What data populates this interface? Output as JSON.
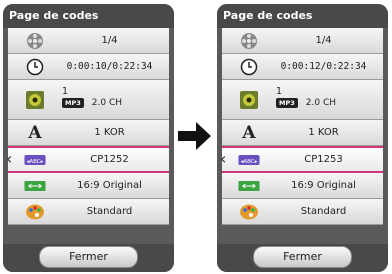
{
  "screens": [
    {
      "title": "Page de codes",
      "rows": {
        "title_num": "1/4",
        "time": "0:00:10/0:22:34",
        "audio_track": "1",
        "audio_codec": "MP3",
        "audio_channels": "2.0 CH",
        "subtitle_lang": "1 KOR",
        "code_page": "CP1252",
        "picture_size": "16:9 Original",
        "picture_mode": "Standard"
      },
      "close_label": "Fermer"
    },
    {
      "title": "Page de codes",
      "rows": {
        "title_num": "1/4",
        "time": "0:00:12/0:22:34",
        "audio_track": "1",
        "audio_codec": "MP3",
        "audio_channels": "2.0 CH",
        "subtitle_lang": "1 KOR",
        "code_page": "CP1253",
        "picture_size": "16:9 Original",
        "picture_mode": "Standard"
      },
      "close_label": "Fermer"
    }
  ],
  "icons": {
    "film": "film-reel-icon",
    "clock": "clock-icon",
    "speaker": "speaker-icon",
    "subtitle": "letter-a-icon",
    "codepage": "abc-icon",
    "size": "aspect-ratio-icon",
    "palette": "palette-icon",
    "transition": "right-arrow-icon"
  },
  "colors": {
    "highlight": "#d4347a",
    "panel": "#5a5a5a"
  }
}
